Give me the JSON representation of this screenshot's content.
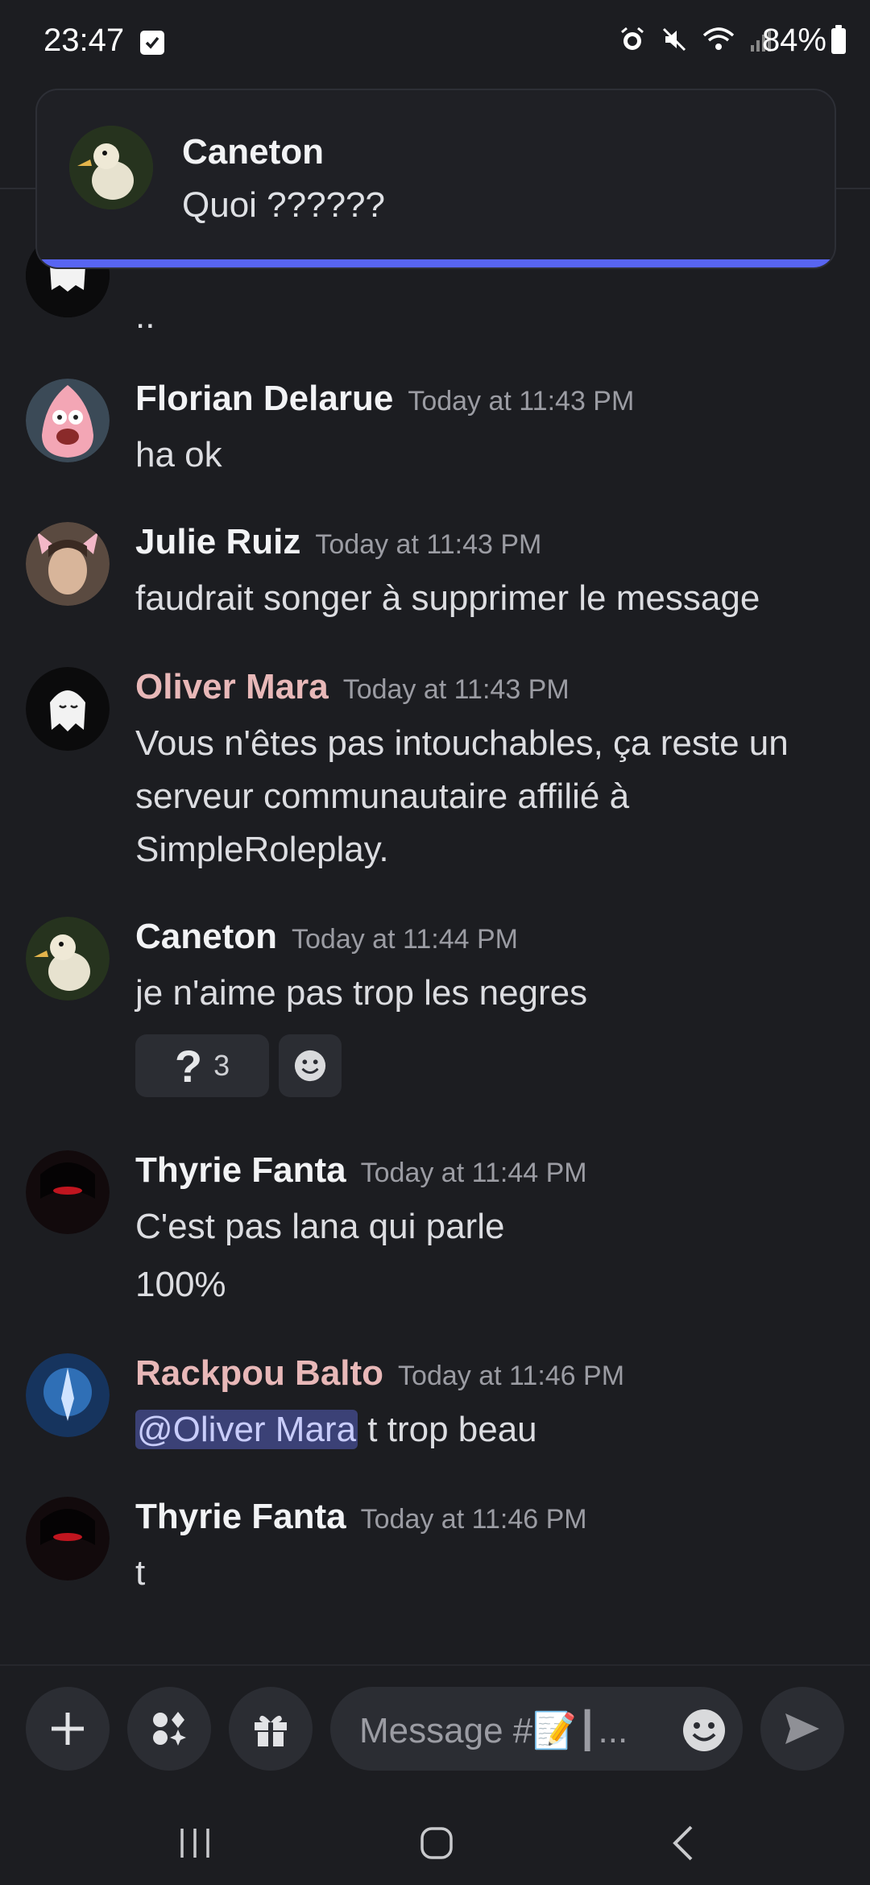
{
  "status_bar": {
    "time": "23:47",
    "battery": "84%"
  },
  "notification": {
    "sender": "Caneton",
    "text": "Quoi ??????"
  },
  "partial_message": {
    "text": ".."
  },
  "messages": [
    {
      "author": "Florian Delarue",
      "time": "Today at 11:43 PM",
      "lines": [
        "ha ok"
      ]
    },
    {
      "author": "Julie Ruiz",
      "time": "Today at 11:43 PM",
      "lines": [
        "faudrait songer à supprimer le message"
      ]
    },
    {
      "author": "Oliver Mara",
      "time": "Today at 11:43 PM",
      "lines": [
        "Vous n'êtes pas intouchables, ça reste un serveur communautaire affilié à SimpleRoleplay."
      ]
    },
    {
      "author": "Caneton",
      "time": "Today at 11:44 PM",
      "lines": [
        "je n'aime pas trop les negres"
      ],
      "reactions": [
        {
          "emoji": "?",
          "count": "3"
        }
      ]
    },
    {
      "author": "Thyrie Fanta",
      "time": "Today at 11:44 PM",
      "lines": [
        "C'est pas lana qui parle",
        "100%"
      ]
    },
    {
      "author": "Rackpou Balto",
      "time": "Today at 11:46 PM",
      "mention": "@Oliver Mara",
      "lines": [
        " t trop beau"
      ]
    },
    {
      "author": "Thyrie Fanta",
      "time": "Today at 11:46 PM",
      "lines": [
        "t"
      ]
    }
  ],
  "composer": {
    "placeholder": "Message #📝┃..."
  },
  "colors": {
    "accent": "#5865f2",
    "background": "#1c1d21",
    "role_pink": "#e8b8b8",
    "mention_bg": "#3b4176"
  }
}
